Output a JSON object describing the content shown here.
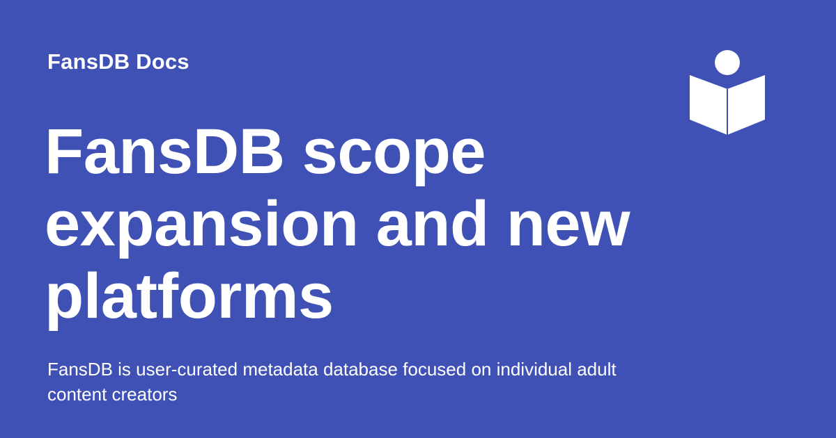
{
  "theme": {
    "background": "#3f51b5",
    "foreground": "#ffffff"
  },
  "site": {
    "name": "FansDB Docs",
    "logo_icon": "reader-book-icon"
  },
  "page": {
    "title": "FansDB scope expansion and new platforms",
    "description": "FansDB is user-curated metadata database focused on individual adult content creators"
  }
}
